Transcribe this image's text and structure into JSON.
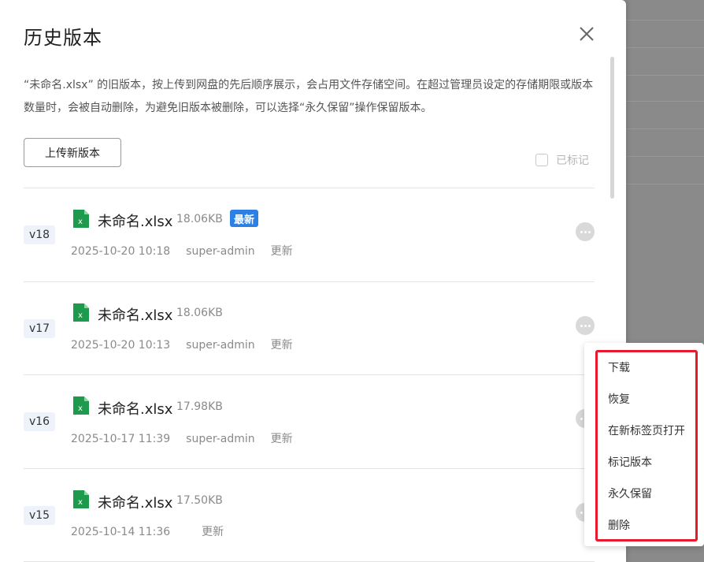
{
  "drawer": {
    "title": "历史版本",
    "description": "“未命名.xlsx” 的旧版本，按上传到网盘的先后顺序展示，会占用文件存储空间。在超过管理员设定的存储期限或版本数量时，会被自动删除，为避免旧版本被删除，可以选择“永久保留”操作保留版本。",
    "upload_button": "上传新版本",
    "marked_label": "已标记"
  },
  "versions": [
    {
      "tag": "v18",
      "name": "未命名.xlsx",
      "size": "18.06KB",
      "badge": "最新",
      "time": "2025-10-20 10:18",
      "user": "super-admin",
      "action": "更新"
    },
    {
      "tag": "v17",
      "name": "未命名.xlsx",
      "size": "18.06KB",
      "time": "2025-10-20 10:13",
      "user": "super-admin",
      "action": "更新"
    },
    {
      "tag": "v16",
      "name": "未命名.xlsx",
      "size": "17.98KB",
      "time": "2025-10-17 11:39",
      "user": "super-admin",
      "action": "更新"
    },
    {
      "tag": "v15",
      "name": "未命名.xlsx",
      "size": "17.50KB",
      "time": "2025-10-14 11:36",
      "user": "",
      "action": "更新"
    }
  ],
  "menu": {
    "items": [
      "下载",
      "恢复",
      "在新标签页打开",
      "标记版本",
      "永久保留",
      "删除"
    ]
  },
  "colors": {
    "accent": "#2b7fe5",
    "highlight": "#e8192c",
    "excel_green": "#1d9a4b"
  }
}
